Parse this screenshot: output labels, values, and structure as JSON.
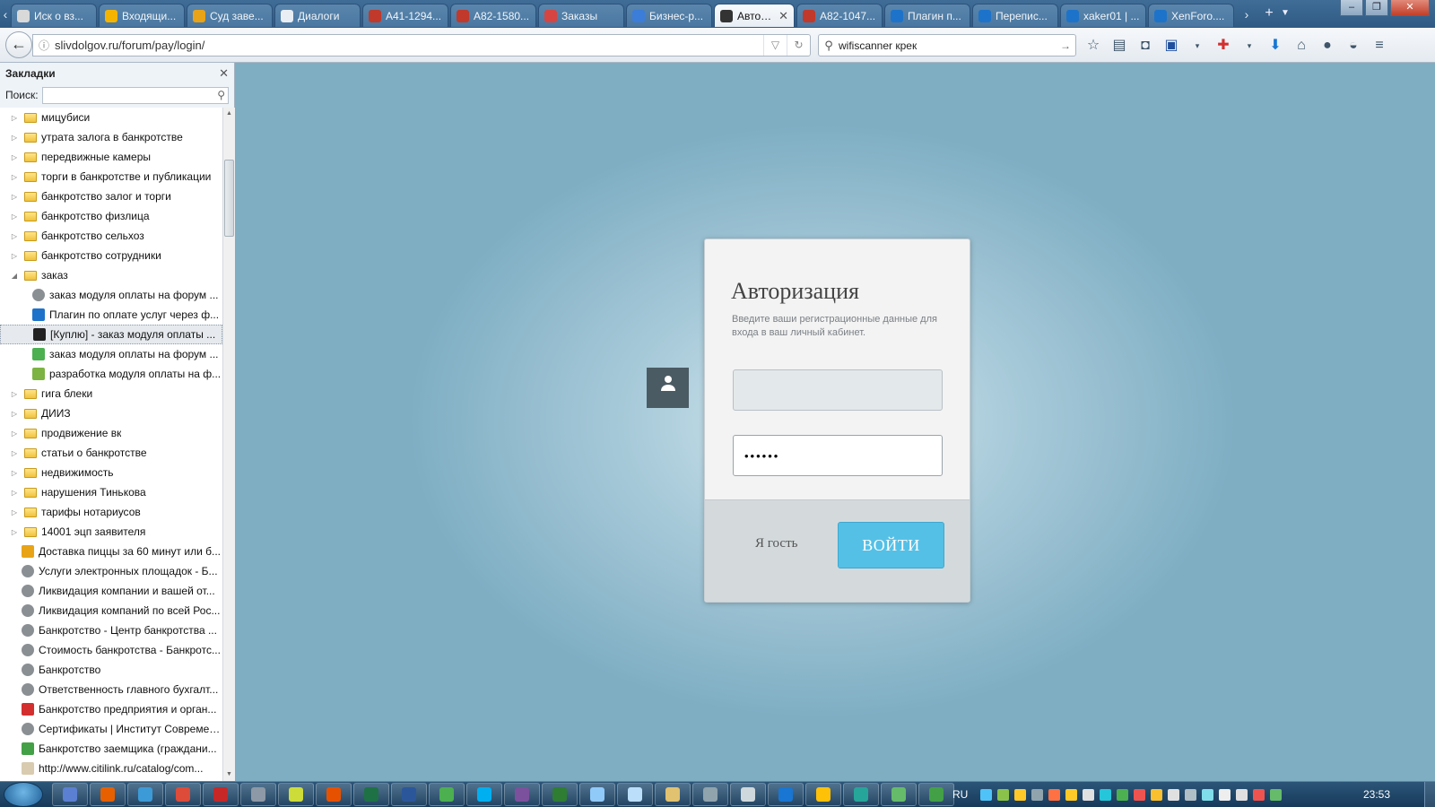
{
  "browser": {
    "tabs": [
      {
        "label": "Иск о вз...",
        "color": "#d9d9d9"
      },
      {
        "label": "Входящи...",
        "color": "#f4b400"
      },
      {
        "label": "Суд заве...",
        "color": "#e8a317"
      },
      {
        "label": "Диалоги",
        "color": "#e8eef4"
      },
      {
        "label": "А41-1294...",
        "color": "#c0392b"
      },
      {
        "label": "А82-1580...",
        "color": "#c0392b"
      },
      {
        "label": "Заказы",
        "color": "#d64541"
      },
      {
        "label": "Бизнес-р...",
        "color": "#3b7dd8"
      },
      {
        "label": "Автор...",
        "color": "#333333"
      },
      {
        "label": "А82-1047...",
        "color": "#c0392b"
      },
      {
        "label": "Плагин п...",
        "color": "#1d73c9"
      },
      {
        "label": "Перепис...",
        "color": "#1d73c9"
      },
      {
        "label": "xaker01 | ...",
        "color": "#1d73c9"
      },
      {
        "label": "XenForo....",
        "color": "#1d73c9"
      }
    ],
    "active_tab_index": 8,
    "url": "slivdolgov.ru/forum/pay/login/",
    "search_value": "wifiscanner крек"
  },
  "sidebar": {
    "title": "Закладки",
    "search_label": "Поиск:",
    "items": [
      {
        "label": "мицубиси",
        "kind": "folder",
        "state": "collapsed"
      },
      {
        "label": "утрата залога в банкротстве",
        "kind": "folder",
        "state": "collapsed"
      },
      {
        "label": "передвижные камеры",
        "kind": "folder",
        "state": "collapsed"
      },
      {
        "label": "торги в банкротстве и публикации",
        "kind": "folder",
        "state": "collapsed"
      },
      {
        "label": "банкротство залог и торги",
        "kind": "folder",
        "state": "collapsed"
      },
      {
        "label": "банкротство физлица",
        "kind": "folder",
        "state": "collapsed"
      },
      {
        "label": "банкротство сельхоз",
        "kind": "folder",
        "state": "collapsed"
      },
      {
        "label": "банкротство сотрудники",
        "kind": "folder",
        "state": "collapsed"
      },
      {
        "label": "заказ",
        "kind": "folder",
        "state": "expanded"
      },
      {
        "label": "заказ модуля оплаты на форум ...",
        "kind": "child",
        "icon": "globe-icon",
        "color": "#8a8f94"
      },
      {
        "label": "Плагин по оплате услуг через ф...",
        "kind": "child",
        "icon": "xf-icon",
        "color": "#1d73c9"
      },
      {
        "label": "[Куплю] - заказ модуля оплаты ...",
        "kind": "child",
        "icon": "hacker-icon",
        "color": "#222222",
        "selected": true
      },
      {
        "label": "заказ модуля оплаты на форум ...",
        "kind": "child",
        "icon": "fl-icon",
        "color": "#4caf50"
      },
      {
        "label": "разработка модуля оплаты на ф...",
        "kind": "child",
        "icon": "ru-icon",
        "color": "#7cb342"
      },
      {
        "label": "гига блеки",
        "kind": "folder",
        "state": "collapsed"
      },
      {
        "label": "ДИИЗ",
        "kind": "folder",
        "state": "collapsed"
      },
      {
        "label": "продвижение вк",
        "kind": "folder",
        "state": "collapsed"
      },
      {
        "label": "статьи о банкротстве",
        "kind": "folder",
        "state": "collapsed"
      },
      {
        "label": "недвижимость",
        "kind": "folder",
        "state": "collapsed"
      },
      {
        "label": "нарушения Тинькова",
        "kind": "folder",
        "state": "collapsed"
      },
      {
        "label": "тарифы нотариусов",
        "kind": "folder",
        "state": "collapsed"
      },
      {
        "label": "14001 эцп заявителя",
        "kind": "folder",
        "state": "collapsed"
      },
      {
        "label": "Доставка пиццы за 60 минут или б...",
        "kind": "bookmark",
        "icon": "pizza-icon",
        "color": "#e8a317"
      },
      {
        "label": "Услуги электронных площадок - Б...",
        "kind": "bookmark",
        "icon": "globe-icon",
        "color": "#8a8f94"
      },
      {
        "label": "Ликвидация компании и вашей от...",
        "kind": "bookmark",
        "icon": "globe-icon",
        "color": "#8a8f94"
      },
      {
        "label": "Ликвидация компаний по всей Рос...",
        "kind": "bookmark",
        "icon": "globe-icon",
        "color": "#8a8f94"
      },
      {
        "label": "Банкротство - Центр банкротства ...",
        "kind": "bookmark",
        "icon": "globe-icon",
        "color": "#8a8f94"
      },
      {
        "label": "Стоимость банкротства - Банкротс...",
        "kind": "bookmark",
        "icon": "globe-icon",
        "color": "#8a8f94"
      },
      {
        "label": "Банкротство",
        "kind": "bookmark",
        "icon": "globe-icon",
        "color": "#8a8f94"
      },
      {
        "label": "Ответственность главного бухгалт...",
        "kind": "bookmark",
        "icon": "globe-icon",
        "color": "#8a8f94"
      },
      {
        "label": "Банкротство предприятия и орган...",
        "kind": "bookmark",
        "icon": "doc-icon",
        "color": "#d32f2f"
      },
      {
        "label": "Сертификаты | Институт Современ...",
        "kind": "bookmark",
        "icon": "globe-icon",
        "color": "#8a8f94"
      },
      {
        "label": "Банкротство заемщика (граждани...",
        "kind": "bookmark",
        "icon": "chart-icon",
        "color": "#43a047"
      },
      {
        "label": "http://www.citilink.ru/catalog/com...",
        "kind": "bookmark",
        "icon": "page-icon",
        "color": "#d8cbb0"
      }
    ]
  },
  "login": {
    "title": "Авторизация",
    "description": "Введите ваши регистрационные данные для входа в ваш личный кабинет.",
    "username_value": "",
    "password_value": "••••••",
    "guest_label": "Я гость",
    "submit_label": "ВОЙТИ"
  },
  "taskbar": {
    "apps": [
      {
        "name": "save-app",
        "color": "#5b7fd1"
      },
      {
        "name": "firefox-app",
        "color": "#e66000"
      },
      {
        "name": "ie-app",
        "color": "#3c9ad6"
      },
      {
        "name": "chrome-app",
        "color": "#dd4b39"
      },
      {
        "name": "pdf-app",
        "color": "#c62828"
      },
      {
        "name": "pen-app",
        "color": "#8d99a6"
      },
      {
        "name": "notes-app",
        "color": "#cddc39"
      },
      {
        "name": "foxit-app",
        "color": "#e65100"
      },
      {
        "name": "excel-app",
        "color": "#1e7145"
      },
      {
        "name": "word-app",
        "color": "#2b579a"
      },
      {
        "name": "puzzle-app",
        "color": "#4caf50"
      },
      {
        "name": "skype-app",
        "color": "#00aff0"
      },
      {
        "name": "viber-app",
        "color": "#7b519d"
      },
      {
        "name": "arrow-app",
        "color": "#2e7d32"
      },
      {
        "name": "doc-app",
        "color": "#90caf9"
      },
      {
        "name": "file-app",
        "color": "#bbdefb"
      },
      {
        "name": "pen2-app",
        "color": "#e0c270"
      },
      {
        "name": "phone-app",
        "color": "#90a4ae"
      },
      {
        "name": "doc2-app",
        "color": "#cfd8dc"
      },
      {
        "name": "mail-app",
        "color": "#1976d2"
      },
      {
        "name": "chat-app",
        "color": "#ffc107"
      },
      {
        "name": "search-app",
        "color": "#26a69a"
      },
      {
        "name": "browser-app",
        "color": "#66bb6a"
      },
      {
        "name": "shield-app",
        "color": "#43a047"
      }
    ],
    "language": "RU",
    "tray_colors": [
      "#4fc3f7",
      "#8bc34a",
      "#ffca28",
      "#90a4ae",
      "#ff7043",
      "#ffca28",
      "#e0e0e0",
      "#26c6da",
      "#4caf50",
      "#ef5350",
      "#fbc02d",
      "#e0e0e0",
      "#b0bec5",
      "#80deea",
      "#eeeeee",
      "#e0e0e0",
      "#ef5350",
      "#66bb6a"
    ],
    "clock": "23:53"
  }
}
